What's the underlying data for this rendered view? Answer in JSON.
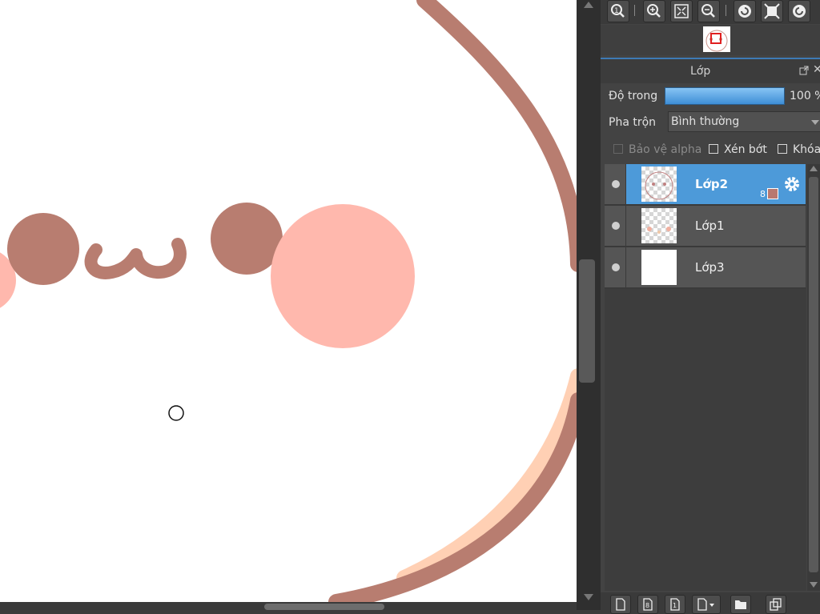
{
  "layers_panel": {
    "title": "Lớp",
    "opacity_label": "Độ trong",
    "opacity_value": "100 %",
    "opacity_fraction": 1.0,
    "blend_label": "Pha trộn",
    "blend_value": "Bình thường",
    "checkbox_protect_alpha": "Bảo vệ alpha",
    "checkbox_clipping": "Xén bớt",
    "checkbox_lock": "Khóa"
  },
  "layers": [
    {
      "name": "Lớp2",
      "selected": true,
      "count": "8"
    },
    {
      "name": "Lớp1",
      "selected": false
    },
    {
      "name": "Lớp3",
      "selected": false
    }
  ],
  "colors": {
    "accent": "#4d9ad9",
    "stroke_brown": "#b87d70",
    "blush_pink": "#ffb8ad",
    "peach": "#ffd0b4"
  },
  "icons": {
    "toolbar": [
      "zoom-reset-icon",
      "zoom-in-icon",
      "fit-window-icon",
      "zoom-out-icon",
      "rotate-left-icon",
      "fullscreen-icon",
      "rotate-right-icon"
    ],
    "bottom": [
      "new-layer-icon",
      "new-8bit-layer-icon",
      "new-1bit-layer-icon",
      "add-special-layer-icon",
      "new-folder-icon",
      "duplicate-layer-icon"
    ]
  }
}
